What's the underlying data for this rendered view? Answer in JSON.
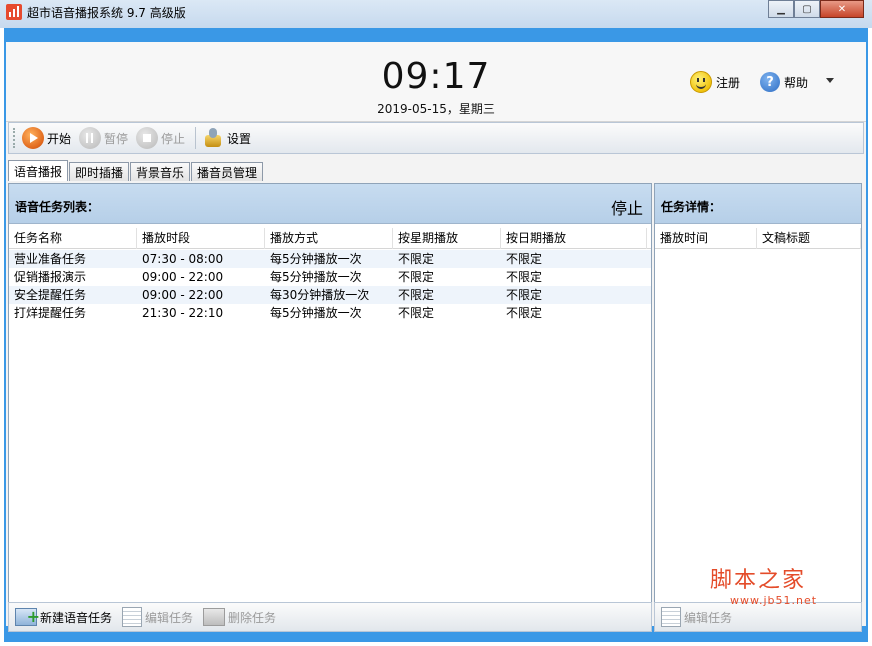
{
  "window": {
    "title": "超市语音播报系统 9.7 高级版"
  },
  "header": {
    "time": "09:17",
    "date": "2019-05-15，星期三",
    "register_label": "注册",
    "help_label": "帮助"
  },
  "toolbar": {
    "start": "开始",
    "pause": "暂停",
    "stop": "停止",
    "settings": "设置"
  },
  "tabs": [
    "语音播报",
    "即时插播",
    "背景音乐",
    "播音员管理"
  ],
  "task_list": {
    "title": "语音任务列表：",
    "status": "停止",
    "columns": [
      "任务名称",
      "播放时段",
      "播放方式",
      "按星期播放",
      "按日期播放"
    ],
    "rows": [
      [
        "营业准备任务",
        "07:30 - 08:00",
        "每5分钟播放一次",
        "不限定",
        "不限定"
      ],
      [
        "促销播报演示",
        "09:00 - 22:00",
        "每5分钟播放一次",
        "不限定",
        "不限定"
      ],
      [
        "安全提醒任务",
        "09:00 - 22:00",
        "每30分钟播放一次",
        "不限定",
        "不限定"
      ],
      [
        "打烊提醒任务",
        "21:30 - 22:10",
        "每5分钟播放一次",
        "不限定",
        "不限定"
      ]
    ]
  },
  "task_detail": {
    "title": "任务详情：",
    "columns": [
      "播放时间",
      "文稿标题"
    ]
  },
  "bottom_left": {
    "new_task": "新建语音任务",
    "edit_task": "编辑任务",
    "delete_task": "删除任务"
  },
  "bottom_right": {
    "edit_task": "编辑任务"
  },
  "watermark": {
    "text": "脚本之家",
    "url": "www.jb51.net"
  }
}
